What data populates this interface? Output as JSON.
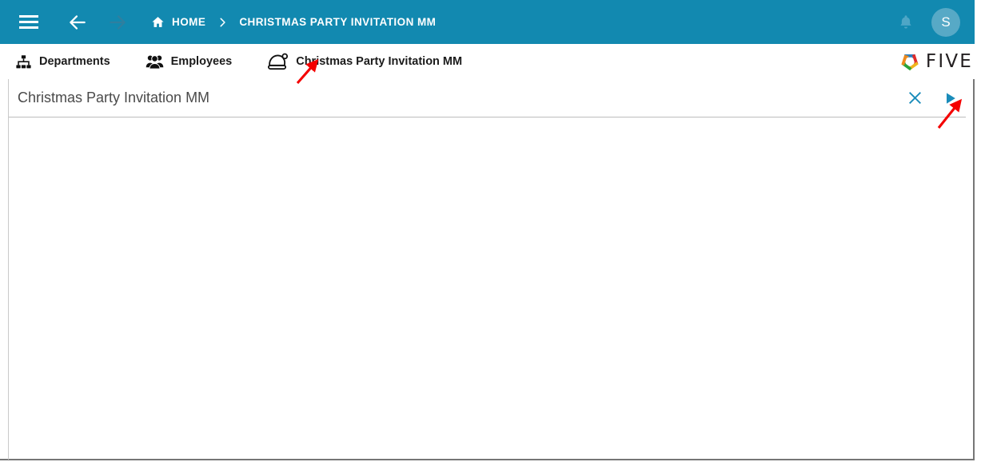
{
  "topbar": {
    "menu_icon": "hamburger-menu-icon",
    "back_icon": "arrow-left-icon",
    "forward_icon": "arrow-right-icon",
    "home_icon": "home-icon",
    "separator_icon": "chevron-right-icon",
    "breadcrumb": [
      {
        "label": "HOME",
        "icon": "home-icon"
      },
      {
        "label": "CHRISTMAS PARTY INVITATION MM",
        "icon": ""
      }
    ],
    "notifications_icon": "bell-icon",
    "avatar_initial": "S",
    "background_color": "#1289b0",
    "text_color": "#ffffff"
  },
  "menubar": {
    "items": [
      {
        "label": "Departments",
        "icon": "sitemap-icon"
      },
      {
        "label": "Employees",
        "icon": "users-icon"
      },
      {
        "label": "Christmas Party Invitation MM",
        "icon": "santa-hat-icon"
      }
    ],
    "brand": {
      "name": "FIVE",
      "logo_icon": "five-pinwheel-logo-icon",
      "logo_colors": [
        "#2a7fc1",
        "#e02b2b",
        "#f0b41c",
        "#2aa33a",
        "#ef8a1b"
      ]
    }
  },
  "page_header": {
    "title": "Christmas Party Invitation MM",
    "actions": [
      {
        "name": "close",
        "icon": "close-x-icon",
        "color": "#1a8cba"
      },
      {
        "name": "run",
        "icon": "play-triangle-icon",
        "color": "#1a8cba"
      }
    ]
  },
  "annotations": [
    {
      "name": "arrow-pointing-to-christmas-tab",
      "color": "#f40000"
    },
    {
      "name": "arrow-pointing-to-run-button",
      "color": "#f40000"
    }
  ],
  "body": {
    "content": ""
  }
}
